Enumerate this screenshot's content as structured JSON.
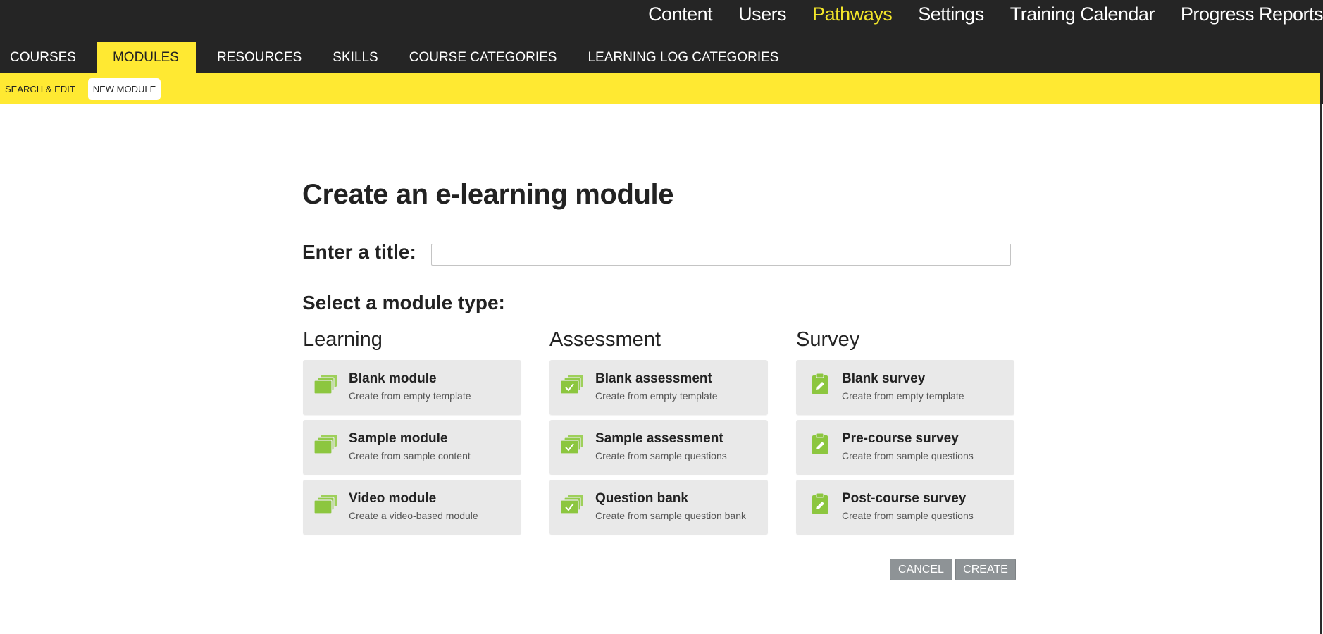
{
  "top_nav": [
    {
      "label": "Content",
      "active": false
    },
    {
      "label": "Users",
      "active": false
    },
    {
      "label": "Pathways",
      "active": true
    },
    {
      "label": "Settings",
      "active": false
    },
    {
      "label": "Training Calendar",
      "active": false
    },
    {
      "label": "Progress Reports",
      "active": false
    }
  ],
  "section_nav": [
    {
      "label": "COURSES",
      "active": false
    },
    {
      "label": "MODULES",
      "active": true
    },
    {
      "label": "RESOURCES",
      "active": false
    },
    {
      "label": "SKILLS",
      "active": false
    },
    {
      "label": "COURSE CATEGORIES",
      "active": false
    },
    {
      "label": "LEARNING LOG CATEGORIES",
      "active": false
    }
  ],
  "sub_nav": {
    "search_edit": "SEARCH & EDIT",
    "new_module": "NEW MODULE"
  },
  "page": {
    "title": "Create an e-learning module",
    "title_label": "Enter a title:",
    "title_value": "",
    "title_placeholder": "",
    "type_label": "Select a module type:"
  },
  "columns": [
    {
      "heading": "Learning",
      "icon": "stacked-folders-icon",
      "cards": [
        {
          "title": "Blank module",
          "subtitle": "Create from empty template"
        },
        {
          "title": "Sample module",
          "subtitle": "Create from sample content"
        },
        {
          "title": "Video module",
          "subtitle": "Create a video-based module"
        }
      ]
    },
    {
      "heading": "Assessment",
      "icon": "checked-stack-icon",
      "cards": [
        {
          "title": "Blank assessment",
          "subtitle": "Create from empty template"
        },
        {
          "title": "Sample assessment",
          "subtitle": "Create from sample questions"
        },
        {
          "title": "Question bank",
          "subtitle": "Create from sample question bank"
        }
      ]
    },
    {
      "heading": "Survey",
      "icon": "clipboard-pencil-icon",
      "cards": [
        {
          "title": "Blank survey",
          "subtitle": "Create from empty template"
        },
        {
          "title": "Pre-course survey",
          "subtitle": "Create from sample questions"
        },
        {
          "title": "Post-course survey",
          "subtitle": "Create from sample questions"
        }
      ]
    }
  ],
  "buttons": {
    "cancel": "CANCEL",
    "create": "CREATE"
  },
  "colors": {
    "header_bg": "#252525",
    "accent_yellow": "#ffe932",
    "active_link": "#f2e52a",
    "icon_green": "#8cc63f",
    "card_bg": "#e9e9e9",
    "button_gray": "#8e9396"
  }
}
